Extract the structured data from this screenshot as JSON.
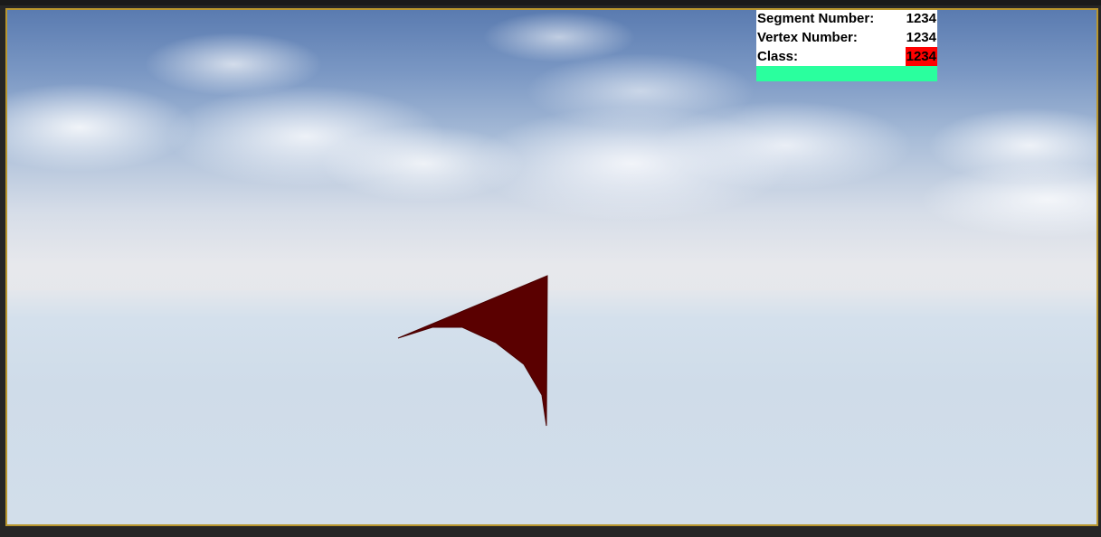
{
  "viewport": {
    "frame_color": "#b8962e",
    "object_color": "#5a0000"
  },
  "info_panel": {
    "segment_label": "Segment Number:",
    "segment_value": "1234",
    "vertex_label": "Vertex Number:",
    "vertex_value": "1234",
    "class_label": "Class:",
    "class_value": "1234",
    "class_highlight_color": "#ff0000",
    "status_bar_color": "#2aff9e"
  }
}
